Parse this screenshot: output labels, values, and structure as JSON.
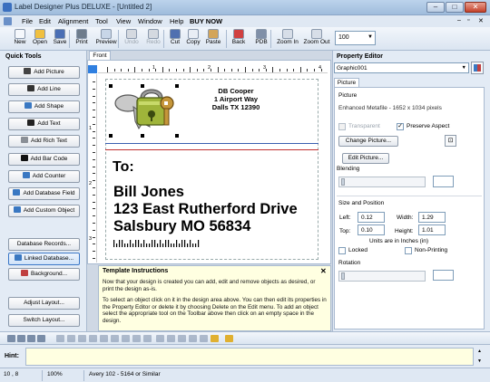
{
  "window": {
    "title": "Label Designer Plus DELUXE  - [Untitled 2]"
  },
  "menu": [
    "File",
    "Edit",
    "Alignment",
    "Tool",
    "View",
    "Window",
    "Help",
    "BUY NOW"
  ],
  "toolbar": {
    "buttons": [
      {
        "label": "New",
        "icon": "new-document-icon",
        "color": "#f5f8fc"
      },
      {
        "label": "Open",
        "icon": "folder-open-icon",
        "color": "#f0c040"
      },
      {
        "label": "Save",
        "icon": "floppy-disk-icon",
        "color": "#4a6fb5"
      },
      {
        "label": "Print",
        "icon": "printer-icon",
        "color": "#6e7c8c"
      },
      {
        "label": "Preview",
        "icon": "print-preview-icon",
        "color": "#c8d6e8"
      },
      {
        "label": "Undo",
        "icon": "undo-icon",
        "color": "#d4d9e0"
      },
      {
        "label": "Redo",
        "icon": "redo-icon",
        "color": "#d4d9e0"
      },
      {
        "label": "Cut",
        "icon": "scissors-icon",
        "color": "#5070b0"
      },
      {
        "label": "Copy",
        "icon": "copy-icon",
        "color": "#e9eef5"
      },
      {
        "label": "Paste",
        "icon": "paste-icon",
        "color": "#d3a55a"
      },
      {
        "label": "Back",
        "icon": "send-back-icon",
        "color": "#d04040"
      },
      {
        "label": "PDB",
        "icon": "pdb-icon",
        "color": "#8090a8"
      },
      {
        "label": "Zoom In",
        "icon": "zoom-in-icon",
        "color": "#d7dee8"
      },
      {
        "label": "Zoom Out",
        "icon": "zoom-out-icon",
        "color": "#d7dee8"
      }
    ],
    "zoom_value": "100"
  },
  "quick_tools": {
    "title": "Quick Tools",
    "buttons": [
      {
        "label": "Add Picture",
        "icon": "camera-icon",
        "color": "#444"
      },
      {
        "label": "Add Line",
        "icon": "line-icon",
        "color": "#333"
      },
      {
        "label": "Add Shape",
        "icon": "shape-icon",
        "color": "#3a78c2"
      },
      {
        "label": "Add Text",
        "icon": "text-icon",
        "color": "#222"
      },
      {
        "label": "Add Rich Text",
        "icon": "rich-text-icon",
        "color": "#8a8f96"
      },
      {
        "label": "Add Bar Code",
        "icon": "barcode-icon",
        "color": "#111"
      },
      {
        "label": "Add Counter",
        "icon": "counter-icon",
        "color": "#3a78c2"
      },
      {
        "label": "Add Database Field",
        "icon": "database-field-icon",
        "color": "#3a78c2"
      },
      {
        "label": "Add Custom Object",
        "icon": "custom-object-icon",
        "color": "#3a78c2"
      },
      {
        "label": "Database Records...",
        "icon": "",
        "color": ""
      },
      {
        "label": "Linked Database...",
        "icon": "link-icon",
        "color": "#3a78c2"
      },
      {
        "label": "Background...",
        "icon": "background-icon",
        "color": "#c04040"
      },
      {
        "label": "Adjust Layout...",
        "icon": "",
        "color": ""
      },
      {
        "label": "Switch Layout...",
        "icon": "",
        "color": ""
      }
    ]
  },
  "design": {
    "tab": "Front",
    "ruler_numbers": [
      "1",
      "2",
      "3",
      "4"
    ],
    "vruler_numbers": [
      "1",
      "2",
      "3"
    ],
    "label": {
      "address_lines": [
        "DB Cooper",
        "1 Airport Way",
        "Dalls TX 12390"
      ],
      "to": "To:",
      "name": "Bill Jones",
      "street": "123 East Rutherford Drive",
      "city": "Salsbury MO 56834"
    }
  },
  "instructions": {
    "title": "Template Instructions",
    "paragraph1": "Now that your design is created you can add, edit and remove objects as desired, or print the design as-is.",
    "paragraph2": "To select an object click on it in the design area above. You can then edit its properties in the Property Editor or delete it by choosing Delete on the Edit menu. To add an object select the appropriate tool on the Toolbar above then click on an empty space in the design."
  },
  "property_editor": {
    "title": "Property Editor",
    "object": "Graphic001",
    "tab": "Picture",
    "section_picture": "Picture",
    "picture_info": "Enhanced Metafile - 1652 x 1034 pixels",
    "transparent_label": "Transparent",
    "preserve_aspect_label": "Preserve Aspect",
    "change_picture": "Change Picture...",
    "edit_picture": "Edit Picture...",
    "blending_label": "Blending",
    "size_position_label": "Size and Position",
    "left_label": "Left:",
    "left_value": "0.12",
    "width_label": "Width:",
    "width_value": "1.29",
    "top_label": "Top:",
    "top_value": "0.10",
    "height_label": "Height:",
    "height_value": "1.01",
    "units_note": "Units are in Inches (in)",
    "locked_label": "Locked",
    "nonprinting_label": "Non-Printing",
    "rotation_label": "Rotation"
  },
  "hint": {
    "label": "Hint:"
  },
  "status": {
    "coords": "10 , 8",
    "zoom": "100%",
    "layout": "Avery 102 - 5164 or Similar"
  }
}
